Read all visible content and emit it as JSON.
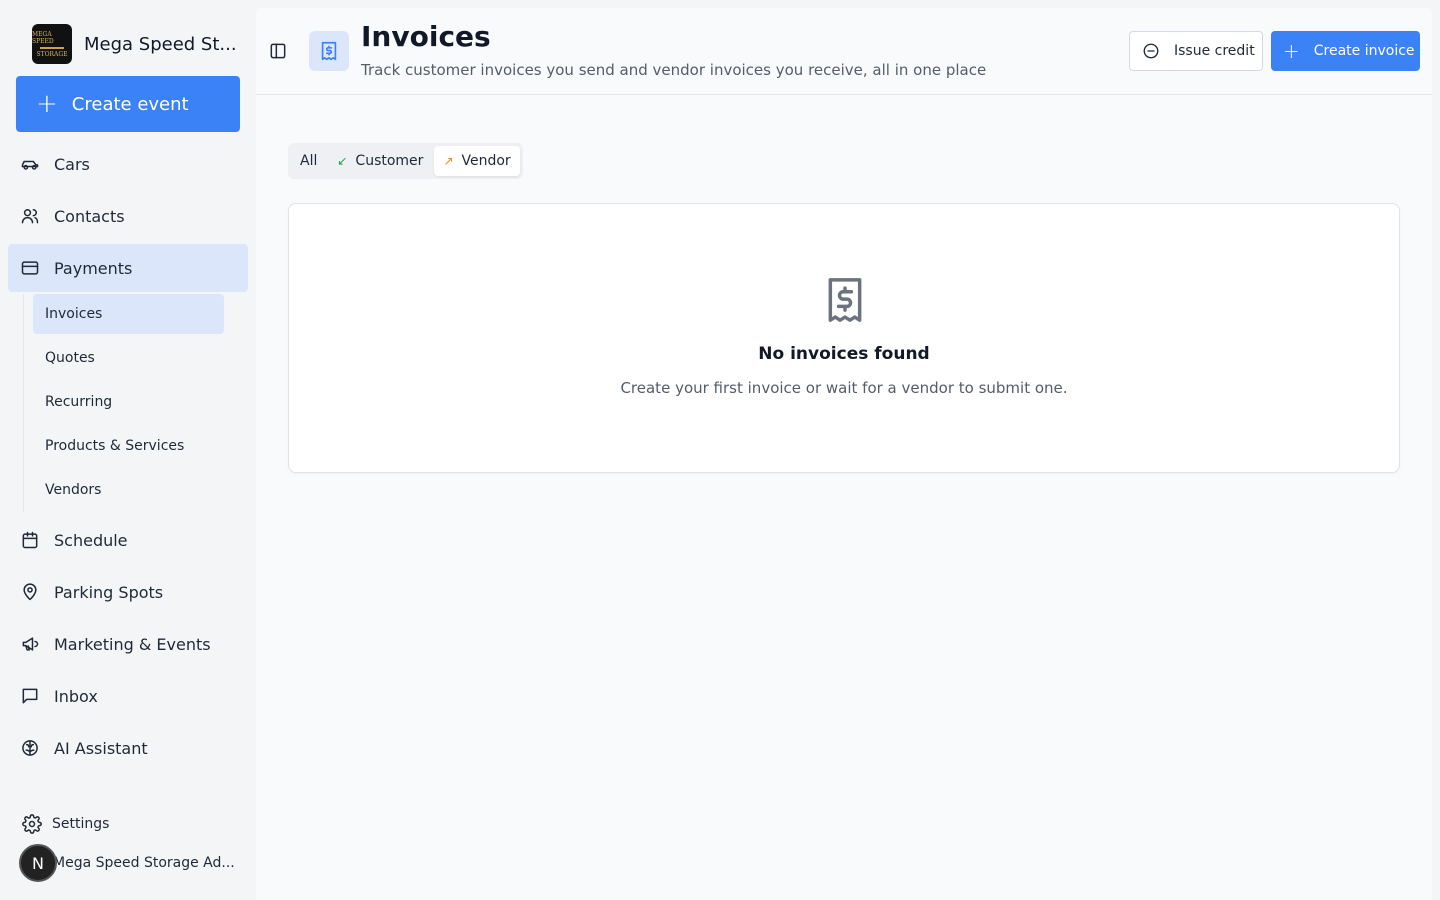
{
  "brand": {
    "name": "Mega Speed St...",
    "logo_text": [
      "MEGA SPEED",
      "STORAGE"
    ]
  },
  "sidebar": {
    "create_label": "Create event",
    "items": [
      {
        "label": "Cars"
      },
      {
        "label": "Contacts"
      },
      {
        "label": "Payments"
      },
      {
        "label": "Schedule"
      },
      {
        "label": "Parking Spots"
      },
      {
        "label": "Marketing & Events"
      },
      {
        "label": "Inbox"
      },
      {
        "label": "AI Assistant"
      }
    ],
    "payments_sub": [
      {
        "label": "Invoices"
      },
      {
        "label": "Quotes"
      },
      {
        "label": "Recurring"
      },
      {
        "label": "Products & Services"
      },
      {
        "label": "Vendors"
      }
    ],
    "settings_label": "Settings",
    "user": {
      "initial": "N",
      "name": "Mega Speed Storage Ad..."
    }
  },
  "header": {
    "title": "Invoices",
    "subtitle": "Track customer invoices you send and vendor invoices you receive, all in one place",
    "issue_credit_label": "Issue credit",
    "create_invoice_label": "Create invoice"
  },
  "filters": {
    "tabs": [
      {
        "label": "All"
      },
      {
        "label": "Customer",
        "icon": "arrow-down-left-icon"
      },
      {
        "label": "Vendor",
        "icon": "arrow-up-right-icon"
      }
    ],
    "active": "Vendor"
  },
  "empty_state": {
    "title": "No invoices found",
    "description": "Create your first invoice or wait for a vendor to submit one."
  },
  "colors": {
    "accent": "#3b82f6",
    "active_bg": "#dbe6fb",
    "customer_arrow": "#16a34a",
    "vendor_arrow": "#ea8a1a"
  }
}
